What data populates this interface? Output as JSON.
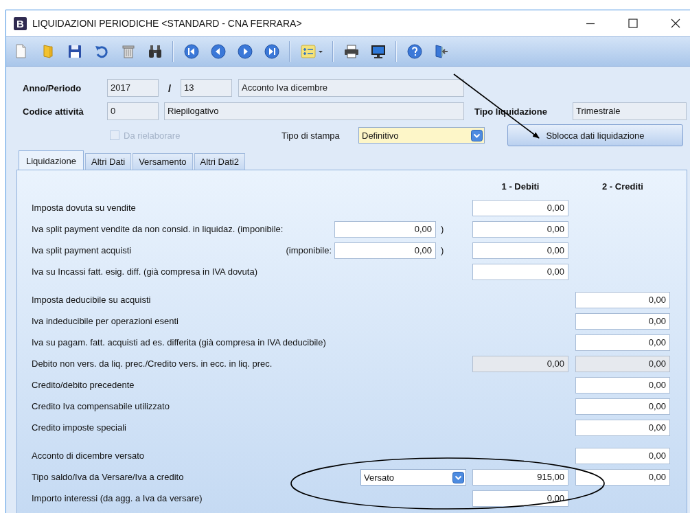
{
  "window": {
    "title": "LIQUIDAZIONI PERIODICHE <STANDARD - CNA FERRARA>",
    "app_badge": "B"
  },
  "toolbar": [
    {
      "kind": "new"
    },
    {
      "kind": "open"
    },
    {
      "kind": "save"
    },
    {
      "kind": "undo"
    },
    {
      "kind": "delete"
    },
    {
      "kind": "find"
    },
    {
      "kind": "separator"
    },
    {
      "kind": "first"
    },
    {
      "kind": "prev"
    },
    {
      "kind": "next"
    },
    {
      "kind": "last"
    },
    {
      "kind": "separator"
    },
    {
      "kind": "list"
    },
    {
      "kind": "separator"
    },
    {
      "kind": "print"
    },
    {
      "kind": "screen"
    },
    {
      "kind": "separator"
    },
    {
      "kind": "help"
    },
    {
      "kind": "exit"
    }
  ],
  "header": {
    "anno_periodo": {
      "label": "Anno/Periodo",
      "year": "2017",
      "slash": "/",
      "period": "13",
      "description": "Acconto Iva dicembre"
    },
    "codice_attivita": {
      "label": "Codice attività",
      "value": "0",
      "description": "Riepilogativo"
    },
    "tipo_liquidazione": {
      "label": "Tipo liquidazione",
      "value": "Trimestrale"
    },
    "da_rielaborare": {
      "label": "Da rielaborare",
      "checked": false,
      "disabled": true
    },
    "tipo_stampa": {
      "label": "Tipo di stampa",
      "value": "Definitivo"
    },
    "unlock_button": "Sblocca dati liquidazione"
  },
  "tabs": [
    {
      "label": "Liquidazione",
      "selected": true
    },
    {
      "label": "Altri Dati",
      "selected": false
    },
    {
      "label": "Versamento",
      "selected": false
    },
    {
      "label": "Altri Dati2",
      "selected": false
    }
  ],
  "columns": [
    "1 - Debiti",
    "2 - Crediti"
  ],
  "row_groups": [
    {
      "rows": [
        {
          "label": "Imposta dovuta su vendite",
          "debit": {
            "value": "0,00",
            "disabled": false
          }
        },
        {
          "label": "Iva split payment vendite da non consid. in liquidaz. (imponibile:",
          "imponibile": {
            "value": "0,00",
            "suffix": ")"
          },
          "debit": {
            "value": "0,00",
            "disabled": false
          }
        },
        {
          "label": "Iva split payment acquisti",
          "imponibile": {
            "label": "(imponibile:",
            "value": "0,00",
            "suffix": ")"
          },
          "debit": {
            "value": "0,00",
            "disabled": false
          }
        },
        {
          "label": "Iva su Incassi fatt. esig. diff. (già compresa in IVA dovuta)",
          "debit": {
            "value": "0,00",
            "disabled": false
          }
        }
      ]
    },
    {
      "rows": [
        {
          "label": "Imposta deducibile su acquisti",
          "credit": {
            "value": "0,00",
            "disabled": false
          }
        },
        {
          "label": "Iva indeducibile per operazioni esenti",
          "credit": {
            "value": "0,00",
            "disabled": false
          }
        },
        {
          "label": "Iva  su pagam. fatt. acquisti ad es. differita (già compresa in IVA deducibile)",
          "credit": {
            "value": "0,00",
            "disabled": false
          }
        },
        {
          "label": "Debito non vers. da liq. prec./Credito vers. in ecc. in liq. prec.",
          "debit": {
            "value": "0,00",
            "disabled": true
          },
          "credit": {
            "value": "0,00",
            "disabled": true
          }
        },
        {
          "label": "Credito/debito precedente",
          "credit": {
            "value": "0,00",
            "disabled": false
          }
        },
        {
          "label": "Credito Iva compensabile utilizzato",
          "credit": {
            "value": "0,00",
            "disabled": false
          }
        },
        {
          "label": "Credito imposte speciali",
          "credit": {
            "value": "0,00",
            "disabled": false
          }
        }
      ]
    },
    {
      "rows": [
        {
          "label": "Acconto di dicembre versato",
          "credit": {
            "value": "0,00",
            "disabled": false
          }
        },
        {
          "label": "Tipo saldo/Iva da Versare/Iva a credito",
          "dropdown": "Versato",
          "debit": {
            "value": "915,00",
            "disabled": false
          },
          "credit": {
            "value": "0,00",
            "disabled": false
          }
        },
        {
          "label": "Importo interessi (da agg. a Iva da versare)",
          "debit": {
            "value": "0,00",
            "disabled": false
          }
        }
      ]
    }
  ]
}
